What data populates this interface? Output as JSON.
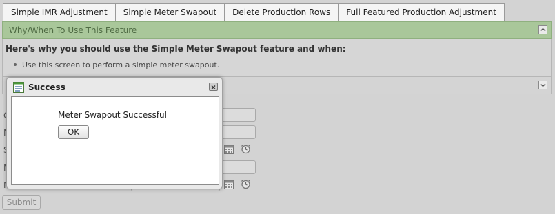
{
  "tabs": [
    {
      "label": "Simple IMR Adjustment"
    },
    {
      "label": "Simple Meter Swapout"
    },
    {
      "label": "Delete Production Rows"
    },
    {
      "label": "Full Featured Production Adjustment"
    }
  ],
  "info_panel": {
    "header": "Why/When To Use This Feature",
    "heading": "Here's why you should use the Simple Meter Swapout feature and when:",
    "bullet": "Use this screen to perform a simple meter swapout."
  },
  "form": {
    "label_fragments": [
      "C",
      "N",
      "S",
      "N",
      "N"
    ],
    "submit_label": "Submit"
  },
  "dialog": {
    "title": "Success",
    "message": "Meter Swapout Successful",
    "ok_label": "OK"
  },
  "icons": {
    "dialog": "window-icon",
    "close": "close-icon",
    "calendar": "calendar-icon",
    "clock": "alarm-clock-icon",
    "collapse": "chevron-up-icon",
    "expand": "chevron-down-icon"
  },
  "colors": {
    "accordion_header": "#a9c79a",
    "page_background": "#d3d3d3"
  }
}
